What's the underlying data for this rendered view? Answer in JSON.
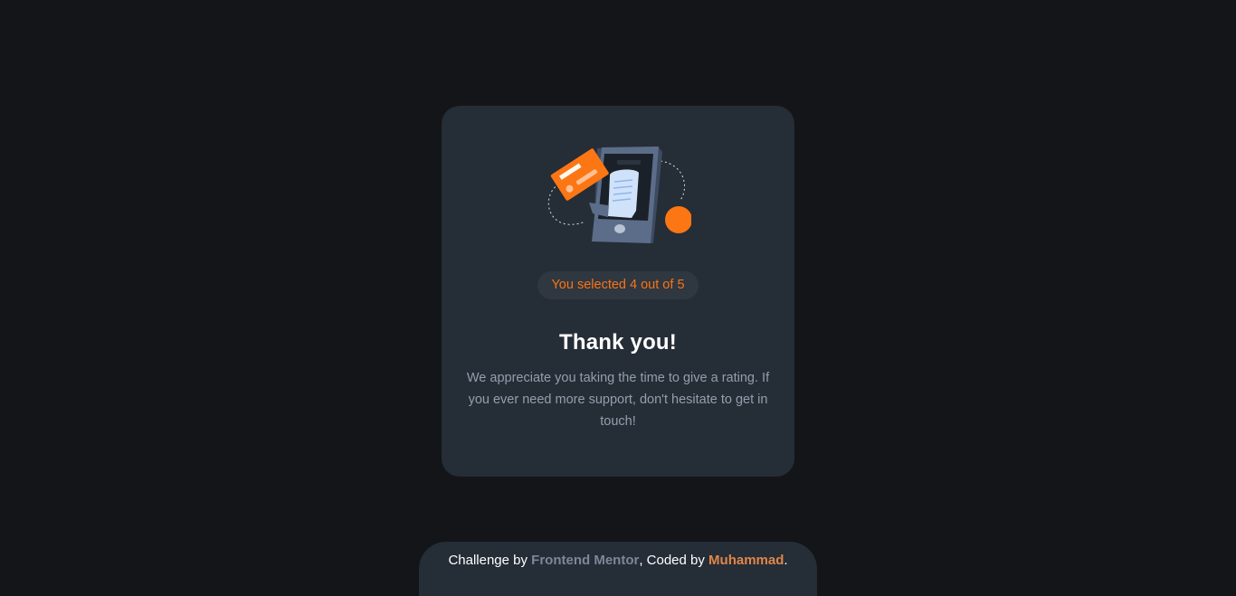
{
  "card": {
    "badge_prefix": "You selected ",
    "rating": "4",
    "badge_middle": " out of ",
    "max_rating": "5",
    "title": "Thank you!",
    "message": "We appreciate you taking the time to give a rating. If you ever need more support, don't hesitate to get in touch!"
  },
  "footer": {
    "prefix": "Challenge by ",
    "challenge_link": "Frontend Mentor",
    "middle": ", Coded by ",
    "author_link": "Muhammad",
    "suffix": "."
  },
  "colors": {
    "background": "#131518",
    "card": "#252d37",
    "accent": "#fb7413",
    "muted_text": "#959eac"
  }
}
